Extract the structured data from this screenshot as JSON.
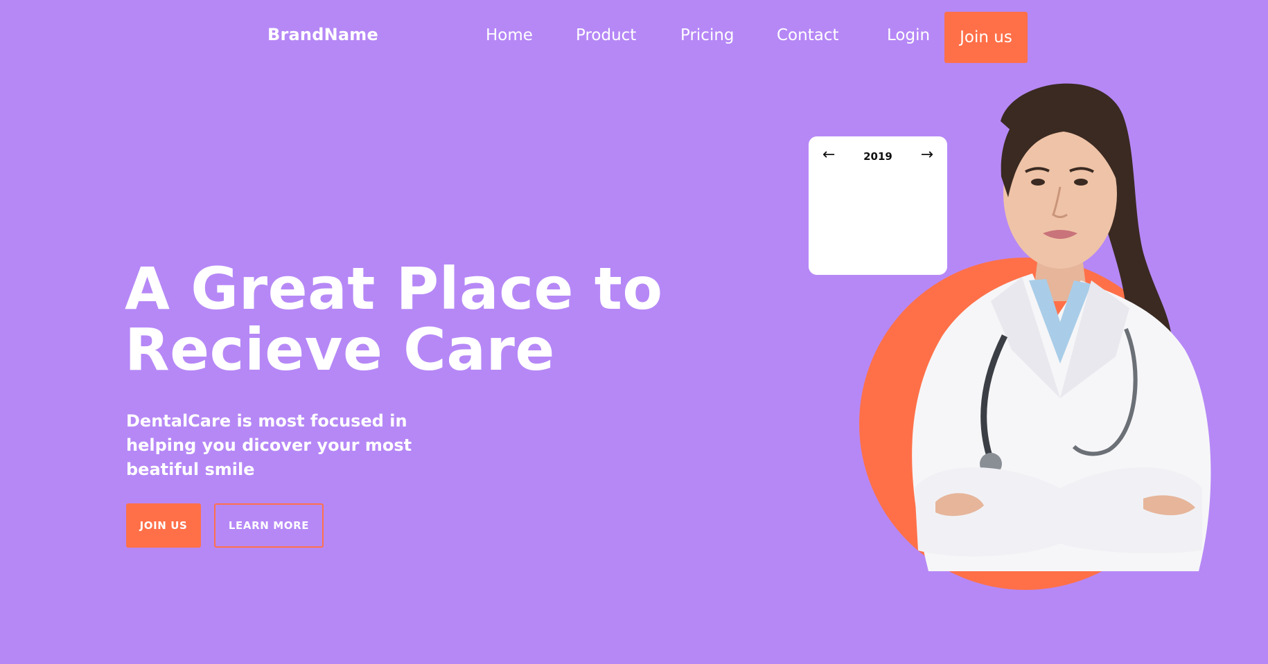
{
  "header": {
    "brand": "BrandName",
    "nav": [
      "Home",
      "Product",
      "Pricing",
      "Contact"
    ],
    "login": "Login",
    "join": "Join us"
  },
  "hero": {
    "title_line1": "A Great Place to",
    "title_line2": "Recieve Care",
    "subtitle": "DentalCare is most focused in helping you dicover your most beatiful smile",
    "join_button": "JOIN US",
    "learn_button": "LEARN MORE"
  },
  "calendar": {
    "prev": "←",
    "year": "2019",
    "next": "→"
  },
  "colors": {
    "background": "#b688f6",
    "accent": "#ff7049",
    "card": "#ffffff",
    "text": "#ffffff"
  },
  "icons": {
    "prev": "arrow-left-icon",
    "next": "arrow-right-icon"
  }
}
